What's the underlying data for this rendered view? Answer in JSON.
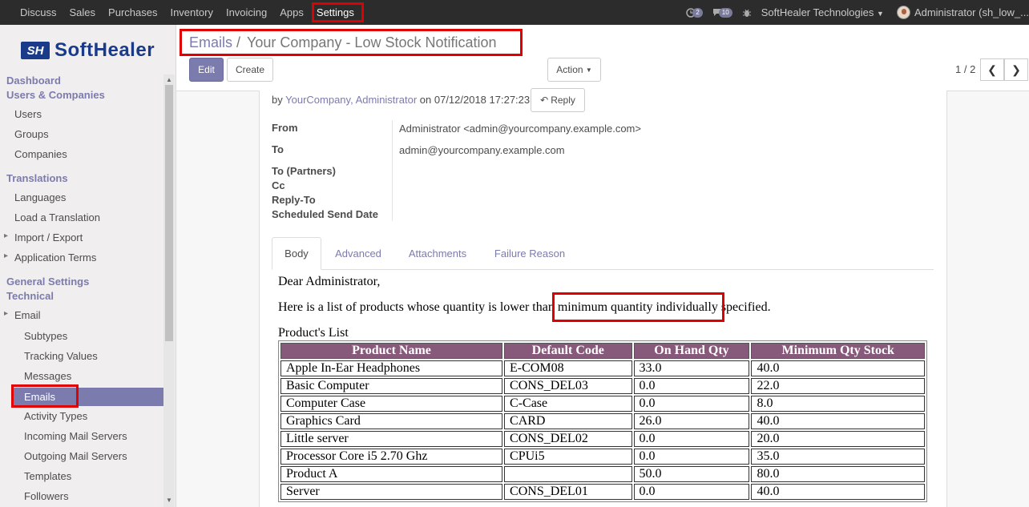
{
  "navbar": {
    "menus": [
      "Discuss",
      "Sales",
      "Purchases",
      "Inventory",
      "Invoicing",
      "Apps",
      "Settings"
    ],
    "activity_count": "2",
    "message_count": "10",
    "company": "SoftHealer Technologies",
    "user": "Administrator (sh_low_..."
  },
  "logo": {
    "mark": "SH",
    "text": "SoftHealer"
  },
  "sidebar": {
    "sections": {
      "dashboard": "Dashboard",
      "users_companies": "Users & Companies",
      "translations": "Translations",
      "general_settings": "General Settings",
      "technical": "Technical"
    },
    "items": {
      "users": "Users",
      "groups": "Groups",
      "companies": "Companies",
      "languages": "Languages",
      "load_translation": "Load a Translation",
      "import_export": "Import / Export",
      "application_terms": "Application Terms",
      "email": "Email",
      "subtypes": "Subtypes",
      "tracking_values": "Tracking Values",
      "messages": "Messages",
      "emails": "Emails",
      "activity_types": "Activity Types",
      "incoming_mail": "Incoming Mail Servers",
      "outgoing_mail": "Outgoing Mail Servers",
      "templates": "Templates",
      "followers": "Followers"
    }
  },
  "breadcrumb": {
    "parent": "Emails",
    "separator": "/",
    "current": "Your Company - Low Stock Notification"
  },
  "toolbar": {
    "edit": "Edit",
    "create": "Create",
    "action": "Action",
    "pager": "1 / 2"
  },
  "message": {
    "by": "by",
    "author": "YourCompany, Administrator",
    "on": "on 07/12/2018 17:27:23",
    "reply": "Reply",
    "fields": {
      "from_label": "From",
      "from_value": "Administrator <admin@yourcompany.example.com>",
      "to_label": "To",
      "to_value": "admin@yourcompany.example.com",
      "to_partners_label": "To (Partners)",
      "cc_label": "Cc",
      "reply_to_label": "Reply-To",
      "scheduled_label": "Scheduled Send Date"
    }
  },
  "tabs": [
    "Body",
    "Advanced",
    "Attachments",
    "Failure Reason"
  ],
  "body": {
    "greeting": "Dear Administrator,",
    "intro_before": "Here is a list of products whose quantity is lower than",
    "intro_highlight": "minimum quantity individually",
    "intro_after": "specified.",
    "list_title": "Product's List",
    "columns": [
      "Product Name",
      "Default Code",
      "On Hand Qty",
      "Minimum Qty Stock"
    ],
    "rows": [
      [
        "Apple In-Ear Headphones",
        "E-COM08",
        "33.0",
        "40.0"
      ],
      [
        "Basic Computer",
        "CONS_DEL03",
        "0.0",
        "22.0"
      ],
      [
        "Computer Case",
        "C-Case",
        "0.0",
        "8.0"
      ],
      [
        "Graphics Card",
        "CARD",
        "26.0",
        "40.0"
      ],
      [
        "Little server",
        "CONS_DEL02",
        "0.0",
        "20.0"
      ],
      [
        "Processor Core i5 2.70 Ghz",
        "CPUi5",
        "0.0",
        "35.0"
      ],
      [
        "Product A",
        "",
        "50.0",
        "80.0"
      ],
      [
        "Server",
        "CONS_DEL01",
        "0.0",
        "40.0"
      ]
    ]
  },
  "colors": {
    "primary": "#7c7bad",
    "table_header": "#875a7b",
    "highlight": "#e00000",
    "navbar": "#2c2c2c"
  }
}
